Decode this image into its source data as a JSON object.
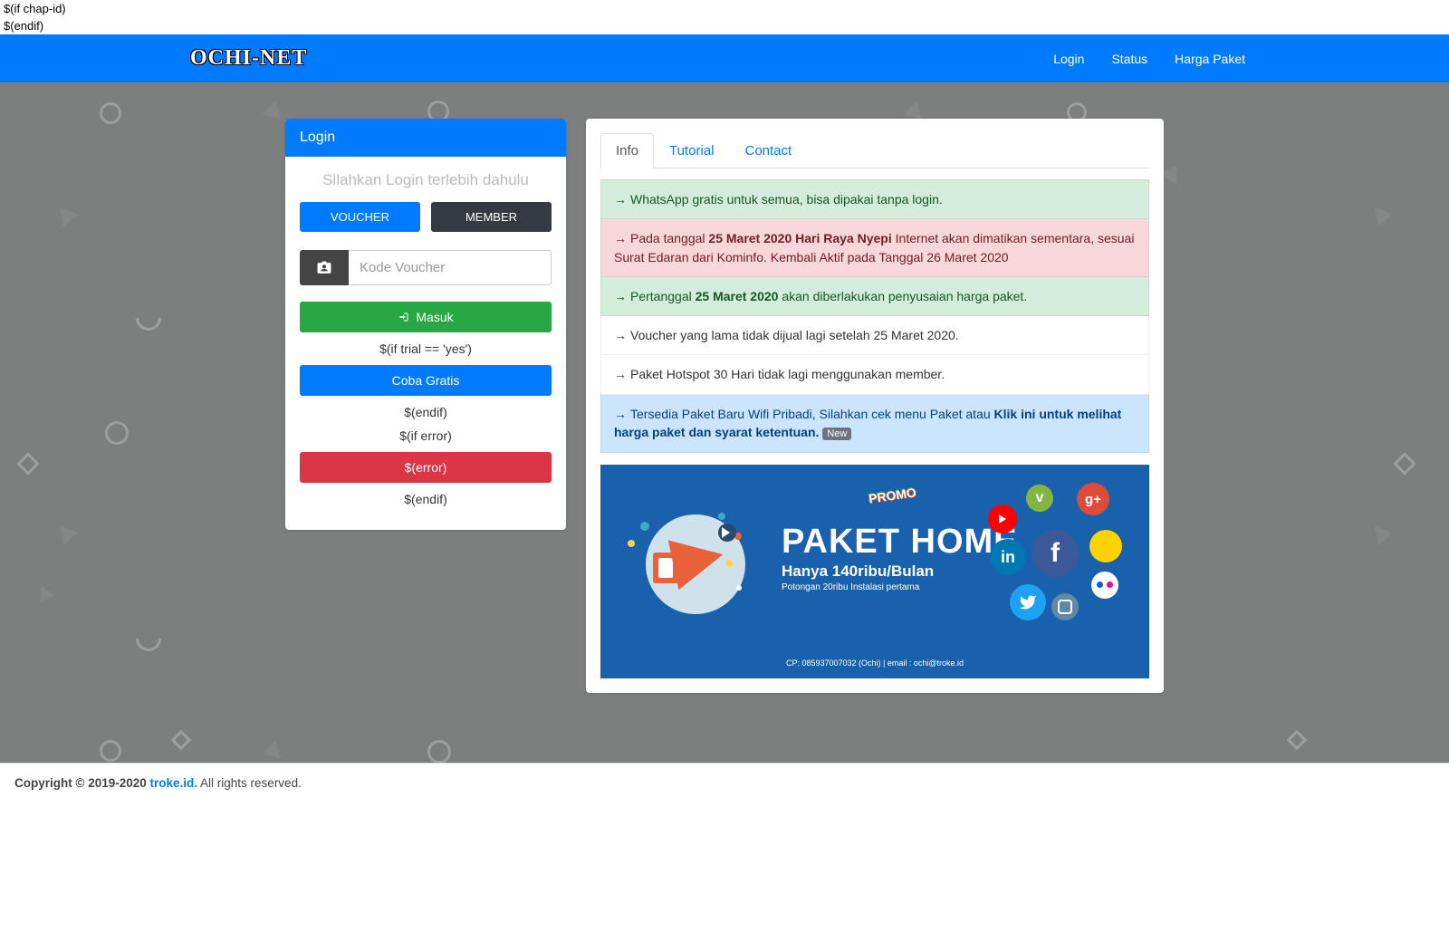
{
  "template": {
    "if_chap": "$(if chap-id)",
    "endif1": "$(endif)",
    "if_trial": "$(if trial == 'yes')",
    "endif2": "$(endif)",
    "if_error": "$(if error)",
    "error": "$(error)",
    "endif3": "$(endif)"
  },
  "navbar": {
    "brand": "OCHI-NET",
    "links": {
      "login": "Login",
      "status": "Status",
      "harga": "Harga Paket"
    }
  },
  "login": {
    "header": "Login",
    "hint": "Silahkan Login terlebih dahulu",
    "tab_voucher": "VOUCHER",
    "tab_member": "MEMBER",
    "placeholder": "Kode Voucher",
    "btn_masuk": "Masuk",
    "btn_coba": "Coba Gratis"
  },
  "tabs": {
    "info": "Info",
    "tutorial": "Tutorial",
    "contact": "Contact"
  },
  "info": {
    "i1": "WhatsApp gratis untuk semua, bisa dipakai tanpa login.",
    "i2a": "Pada tanggal ",
    "i2b": "25 Maret 2020 Hari Raya Nyepi",
    "i2c": " Internet akan dimatikan sementara, sesuai Surat Edaran dari Kominfo. Kembali Aktif pada Tanggal 26 Maret 2020",
    "i3a": "Pertanggal ",
    "i3b": "25 Maret 2020",
    "i3c": " akan diberlakukan penyusaian harga paket.",
    "i4": "Voucher yang lama tidak dijual lagi setelah 25 Maret 2020.",
    "i5": "Paket Hotspot 30 Hari tidak lagi menggunakan member.",
    "i6a": "Tersedia Paket Baru Wifi Pribadi, Silahkan cek menu Paket atau ",
    "i6b": "Klik ini untuk melihat harga paket dan syarat ketentuan.",
    "i6badge": "New"
  },
  "promo": {
    "badge": "PROMO",
    "title": "PAKET HOME",
    "sub": "Hanya 140ribu/Bulan",
    "small": "Potongan 20ribu Instalasi pertama",
    "contact": "CP: 085937007032 (Ochi) | email : ochi@troke.id",
    "fb": "f",
    "in": "in",
    "gp": "g+",
    "vm": "v"
  },
  "footer": {
    "copy": "Copyright © 2019-2020 ",
    "link": "troke.id.",
    "rights": " All rights reserved."
  }
}
